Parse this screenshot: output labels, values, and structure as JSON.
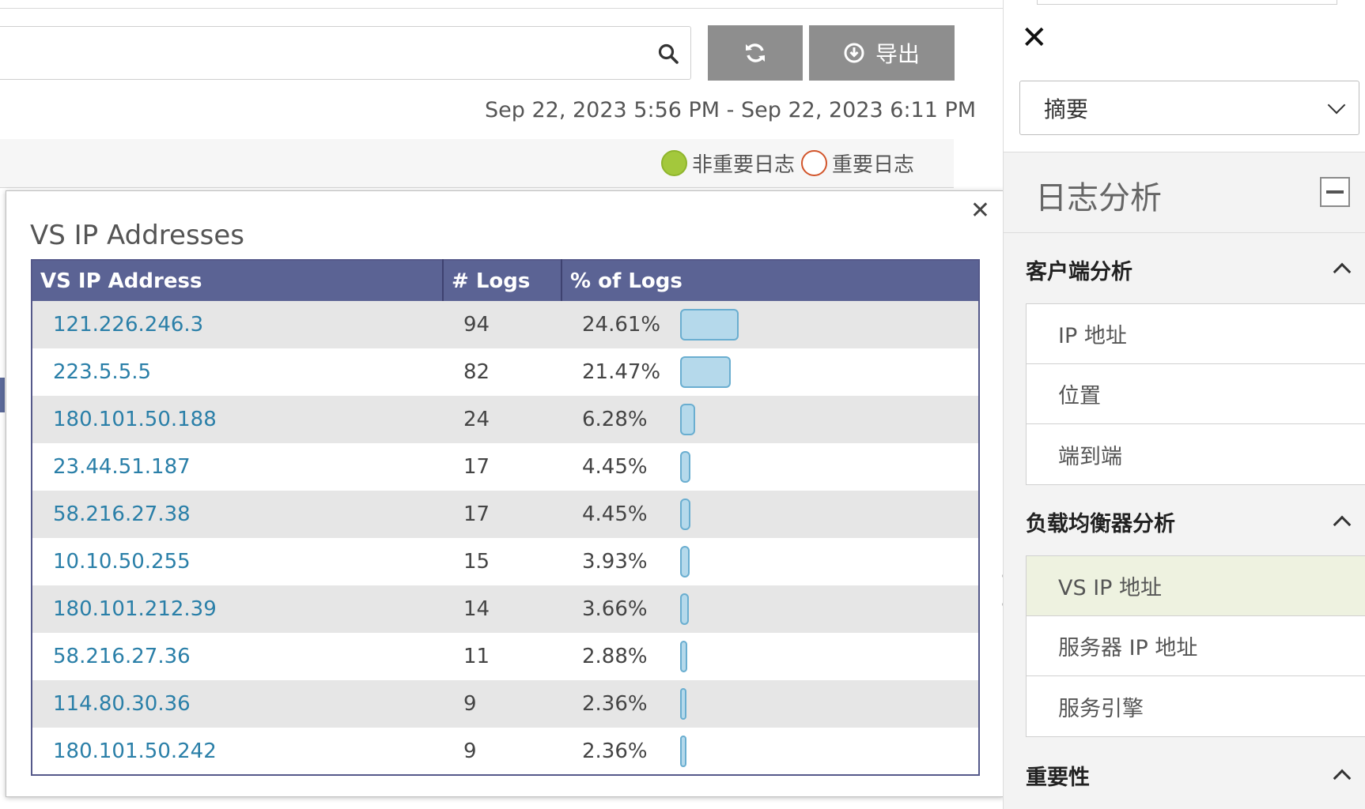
{
  "toolbar": {
    "search_placeholder": "",
    "export_label": "导出",
    "time_range": "Sep 22, 2023 5:56 PM - Sep 22, 2023 6:11 PM"
  },
  "legend": {
    "non_significant": "非重要日志",
    "significant": "重要日志",
    "non_significant_color": "#a3c83c",
    "significant_color": "#d2552b"
  },
  "popup": {
    "title": "VS IP Addresses",
    "columns": [
      "VS IP Address",
      "# Logs",
      "% of Logs"
    ],
    "rows": [
      {
        "ip": "121.226.246.3",
        "logs": "94",
        "pct": "24.61%",
        "pct_value": 24.61
      },
      {
        "ip": "223.5.5.5",
        "logs": "82",
        "pct": "21.47%",
        "pct_value": 21.47
      },
      {
        "ip": "180.101.50.188",
        "logs": "24",
        "pct": "6.28%",
        "pct_value": 6.28
      },
      {
        "ip": "23.44.51.187",
        "logs": "17",
        "pct": "4.45%",
        "pct_value": 4.45
      },
      {
        "ip": "58.216.27.38",
        "logs": "17",
        "pct": "4.45%",
        "pct_value": 4.45
      },
      {
        "ip": "10.10.50.255",
        "logs": "15",
        "pct": "3.93%",
        "pct_value": 3.93
      },
      {
        "ip": "180.101.212.39",
        "logs": "14",
        "pct": "3.66%",
        "pct_value": 3.66
      },
      {
        "ip": "58.216.27.36",
        "logs": "11",
        "pct": "2.88%",
        "pct_value": 2.88
      },
      {
        "ip": "114.80.30.36",
        "logs": "9",
        "pct": "2.36%",
        "pct_value": 2.36
      },
      {
        "ip": "180.101.50.242",
        "logs": "9",
        "pct": "2.36%",
        "pct_value": 2.36
      }
    ],
    "bar_color": "#b5d9eb"
  },
  "sidebar": {
    "view_select": "摘要",
    "section_title": "日志分析",
    "groups": [
      {
        "title": "客户端分析",
        "items": [
          "IP 地址",
          "位置",
          "端到端"
        ]
      },
      {
        "title": "负载均衡器分析",
        "items": [
          "VS IP 地址",
          "服务器 IP 地址",
          "服务引擎"
        ],
        "active_index": 0
      },
      {
        "title": "重要性",
        "items": []
      }
    ]
  }
}
